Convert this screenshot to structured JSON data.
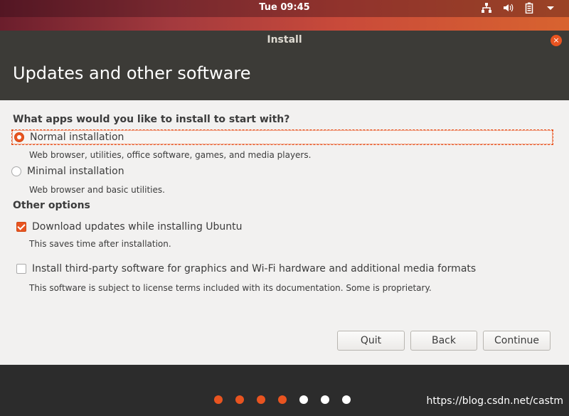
{
  "topbar": {
    "clock": "Tue 09:45",
    "icons": [
      "network-icon",
      "volume-icon",
      "battery-icon",
      "menu-arrow-icon"
    ]
  },
  "window": {
    "title": "Install",
    "close_icon": "×"
  },
  "header": {
    "title": "Updates and other software"
  },
  "content": {
    "question": "What apps would you like to install to start with?",
    "install_options": [
      {
        "label": "Normal installation",
        "description": "Web browser, utilities, office software, games, and media players.",
        "selected": true
      },
      {
        "label": "Minimal installation",
        "description": "Web browser and basic utilities.",
        "selected": false
      }
    ],
    "other_options_heading": "Other options",
    "other_options": [
      {
        "label": "Download updates while installing Ubuntu",
        "description": "This saves time after installation.",
        "checked": true
      },
      {
        "label": "Install third-party software for graphics and Wi-Fi hardware and additional media formats",
        "description": "This software is subject to license terms included with its documentation. Some is proprietary.",
        "checked": false
      }
    ]
  },
  "buttons": {
    "quit": "Quit",
    "back": "Back",
    "continue": "Continue"
  },
  "progress": {
    "total_steps": 7,
    "completed_steps": 4
  },
  "watermark": "https://blog.csdn.net/castm",
  "colors": {
    "accent": "#e95420",
    "header_bg": "#3c3b37",
    "window_bg": "#f2f1f0",
    "footer_bg": "#2c2c2c"
  }
}
